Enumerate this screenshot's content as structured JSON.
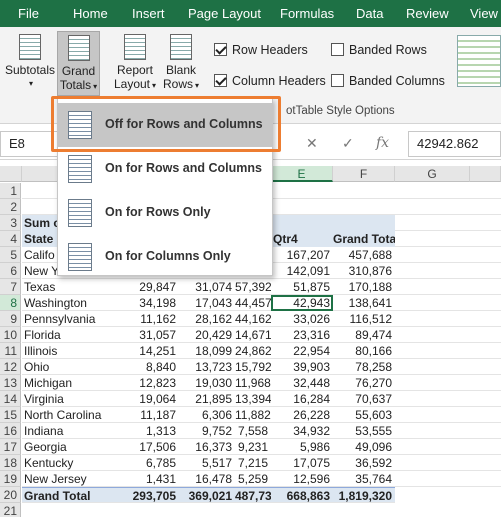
{
  "tabs": [
    "File",
    "Home",
    "Insert",
    "Page Layout",
    "Formulas",
    "Data",
    "Review",
    "View"
  ],
  "ribbon": {
    "subtotals": "Subtotals",
    "grand_totals_1": "Grand",
    "grand_totals_2": "Totals",
    "report_layout_1": "Report",
    "report_layout_2": "Layout",
    "blank_rows_1": "Blank",
    "blank_rows_2": "Rows",
    "row_headers": "Row Headers",
    "column_headers": "Column Headers",
    "banded_rows": "Banded Rows",
    "banded_columns": "Banded Columns",
    "style_options_label": "otTable Style Options",
    "row_headers_checked": true,
    "column_headers_checked": true,
    "banded_rows_checked": false,
    "banded_columns_checked": false
  },
  "formula_bar": {
    "name_box": "E8",
    "cancel": "✕",
    "enter": "✓",
    "fx": "fx",
    "value": "42942.862"
  },
  "columns": [
    "E",
    "F",
    "G"
  ],
  "rows": [
    "1",
    "2",
    "3",
    "4",
    "5",
    "6",
    "7",
    "8",
    "9",
    "10",
    "11",
    "12",
    "13",
    "14",
    "15",
    "16",
    "17",
    "18",
    "19",
    "20",
    "21"
  ],
  "pivot": {
    "title_partial": "Sum of",
    "state_header": "State",
    "qtr4_header": "Qtr4",
    "grand_total_header": "Grand Total",
    "records": [
      {
        "state": "Califo",
        "q1": "",
        "q2": "",
        "q3": "",
        "q4": "167,207",
        "total": "457,688"
      },
      {
        "state": "New Y",
        "q1": "",
        "q2": "",
        "q3": "",
        "q4": "142,091",
        "total": "310,876"
      },
      {
        "state": "Texas",
        "q1": "29,847",
        "q2": "31,074",
        "q3": "57,392",
        "q4": "51,875",
        "total": "170,188"
      },
      {
        "state": "Washington",
        "q1": "34,198",
        "q2": "17,043",
        "q3": "44,457",
        "q4": "42,943",
        "total": "138,641"
      },
      {
        "state": "Pennsylvania",
        "q1": "11,162",
        "q2": "28,162",
        "q3": "44,162",
        "q4": "33,026",
        "total": "116,512"
      },
      {
        "state": "Florida",
        "q1": "31,057",
        "q2": "20,429",
        "q3": "14,671",
        "q4": "23,316",
        "total": "89,474"
      },
      {
        "state": "Illinois",
        "q1": "14,251",
        "q2": "18,099",
        "q3": "24,862",
        "q4": "22,954",
        "total": "80,166"
      },
      {
        "state": "Ohio",
        "q1": "8,840",
        "q2": "13,723",
        "q3": "15,792",
        "q4": "39,903",
        "total": "78,258"
      },
      {
        "state": "Michigan",
        "q1": "12,823",
        "q2": "19,030",
        "q3": "11,968",
        "q4": "32,448",
        "total": "76,270"
      },
      {
        "state": "Virginia",
        "q1": "19,064",
        "q2": "21,895",
        "q3": "13,394",
        "q4": "16,284",
        "total": "70,637"
      },
      {
        "state": "North Carolina",
        "q1": "11,187",
        "q2": "6,306",
        "q3": "11,882",
        "q4": "26,228",
        "total": "55,603"
      },
      {
        "state": "Indiana",
        "q1": "1,313",
        "q2": "9,752",
        "q3": "7,558",
        "q4": "34,932",
        "total": "53,555"
      },
      {
        "state": "Georgia",
        "q1": "17,506",
        "q2": "16,373",
        "q3": "9,231",
        "q4": "5,986",
        "total": "49,096"
      },
      {
        "state": "Kentucky",
        "q1": "6,785",
        "q2": "5,517",
        "q3": "7,215",
        "q4": "17,075",
        "total": "36,592"
      },
      {
        "state": "New Jersey",
        "q1": "1,431",
        "q2": "16,478",
        "q3": "5,259",
        "q4": "12,596",
        "total": "35,764"
      }
    ],
    "grand_total": {
      "label": "Grand Total",
      "q1": "293,705",
      "q2": "369,021",
      "q3": "487,730",
      "q4": "668,863",
      "total": "1,819,320"
    }
  },
  "dropdown": {
    "items": [
      "Off for Rows and Columns",
      "On for Rows and Columns",
      "On for Rows Only",
      "On for Columns Only"
    ]
  },
  "colors": {
    "excel_green": "#1e7145",
    "highlight_orange": "#ed7d31",
    "pivot_blue": "#dce6f1"
  }
}
